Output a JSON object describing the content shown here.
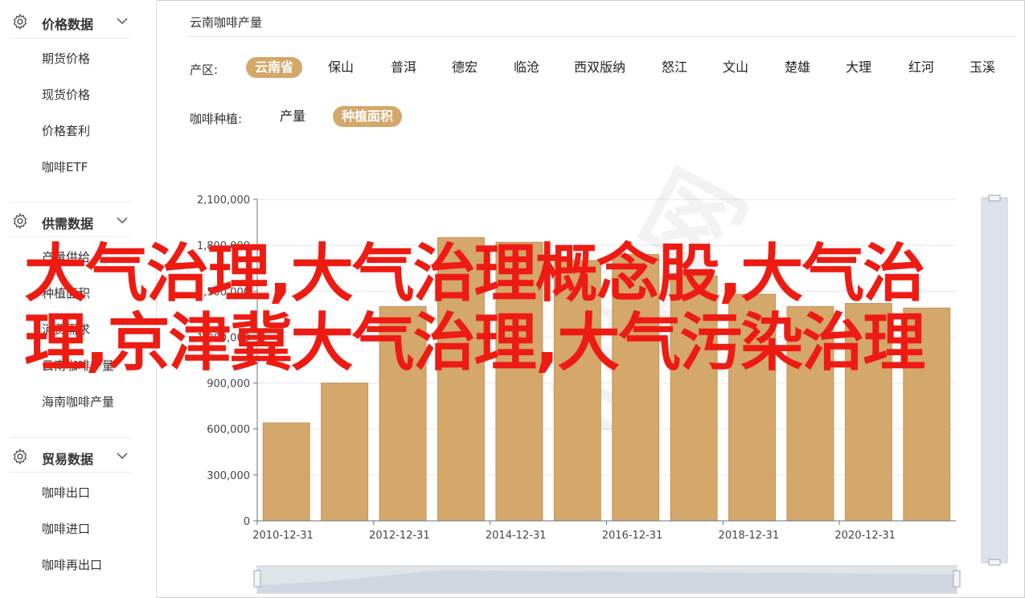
{
  "sidebar": {
    "groups": [
      {
        "title": "价格数据",
        "items": [
          "期货价格",
          "现货价格",
          "价格套利",
          "咖啡ETF"
        ]
      },
      {
        "title": "供需数据",
        "items": [
          "产量供给",
          "种植面积",
          "消费需求",
          "云南咖啡产量",
          "海南咖啡产量"
        ]
      },
      {
        "title": "贸易数据",
        "items": [
          "咖啡出口",
          "咖啡进口",
          "咖啡再出口"
        ]
      }
    ]
  },
  "main": {
    "title": "云南咖啡产量",
    "region_label": "产区:",
    "regions": [
      "云南省",
      "保山",
      "普洱",
      "德宏",
      "临沧",
      "西双版纳",
      "怒江",
      "文山",
      "楚雄",
      "大理",
      "红河",
      "玉溪"
    ],
    "region_active": "云南省",
    "planting_label": "咖啡种植:",
    "planting_options": [
      "产量",
      "种植面积"
    ],
    "planting_active": "种植面积"
  },
  "overlay_text": {
    "line1": "大气治理,大气治理概念股,大气治",
    "line2": "理,京津冀大气治理,大气污染治理"
  },
  "colors": {
    "bar": "#d4a76a",
    "bar_edge": "#c39556",
    "accent": "#d4a76a",
    "overlay": "#ee1b12"
  },
  "chart_data": {
    "type": "bar",
    "categories": [
      "2010-12-31",
      "2011-12-31",
      "2012-12-31",
      "2013-12-31",
      "2014-12-31",
      "2015-12-31",
      "2016-12-31",
      "2017-12-31",
      "2018-12-31",
      "2019-12-31",
      "2020-12-31",
      "2021-12-31"
    ],
    "x_tick_labels": [
      "2010-12-31",
      "2012-12-31",
      "2014-12-31",
      "2016-12-31",
      "2018-12-31",
      "2020-12-31"
    ],
    "values": [
      640000,
      900000,
      1400000,
      1850000,
      1820000,
      1700000,
      1740000,
      1600000,
      1480000,
      1400000,
      1420000,
      1390000
    ],
    "ylim": [
      0,
      2100000
    ],
    "y_ticks": [
      0,
      300000,
      600000,
      900000,
      1200000,
      1500000,
      1800000,
      2100000
    ],
    "y_tick_labels": [
      "0",
      "300,000",
      "600,000",
      "900,000",
      "1,200,000",
      "1,500,000",
      "1,800,000",
      "2,100,000"
    ],
    "grid": true,
    "title": "",
    "xlabel": "",
    "ylabel": ""
  }
}
